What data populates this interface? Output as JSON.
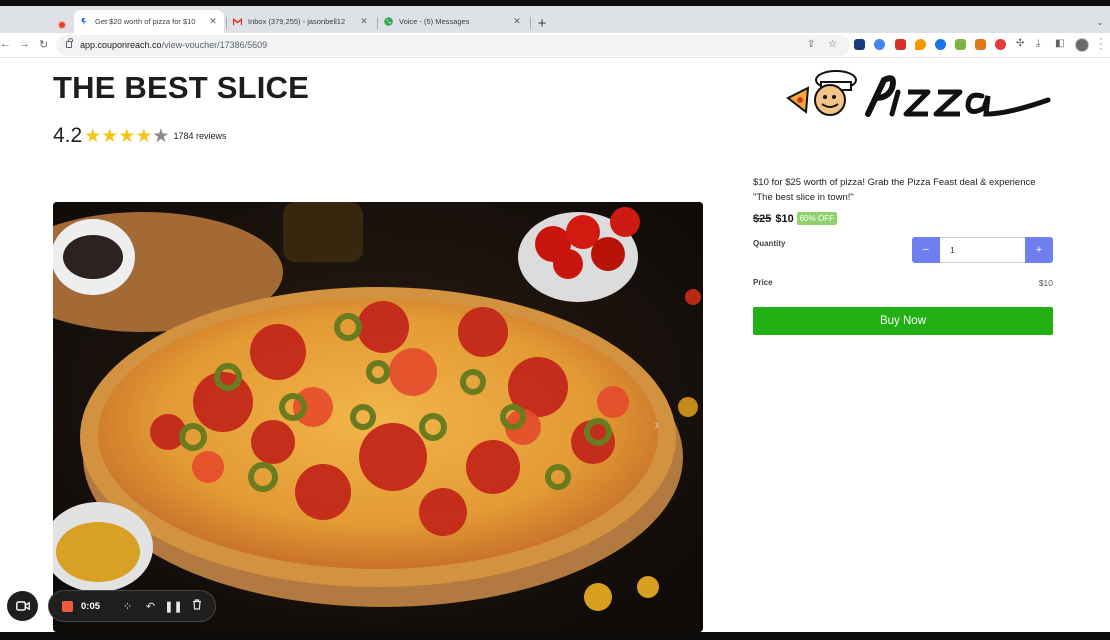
{
  "browser": {
    "tabs": [
      {
        "title": "Get $20 worth of pizza for $10",
        "favicon": "couponreach-favicon-icon",
        "active": true
      },
      {
        "title": "Inbox (379,255) - jasonbell12",
        "favicon": "gmail-icon",
        "active": false
      },
      {
        "title": "Voice - (5) Messages",
        "favicon": "voice-phone-icon",
        "active": false
      }
    ],
    "url_host": "app.couponreach.co",
    "url_path": "/view-voucher/17386/5609",
    "new_tab_symbol": "+"
  },
  "page": {
    "title": "THE BEST SLICE",
    "rating": "4.2",
    "rating_value": 4.2,
    "rating_max": 5,
    "reviews": "1784 reviews"
  },
  "deal": {
    "description": "$10 for $25 worth of pizza! Grab the Pizza Feast deal & experience \"The best slice in town!\"",
    "old_price": "$25",
    "new_price": "$10",
    "badge": "60% OFF",
    "quantity_label": "Quantity",
    "quantity_value": "1",
    "minus_label": "−",
    "plus_label": "+",
    "price_label": "Price",
    "price_value": "$10",
    "buy_label": "Buy Now"
  },
  "recorder": {
    "time": "0:05"
  },
  "colors": {
    "buy_button": "#22b014",
    "stepper": "#6f7ff0",
    "badge": "#8fd16d",
    "star": "#f5c518"
  }
}
